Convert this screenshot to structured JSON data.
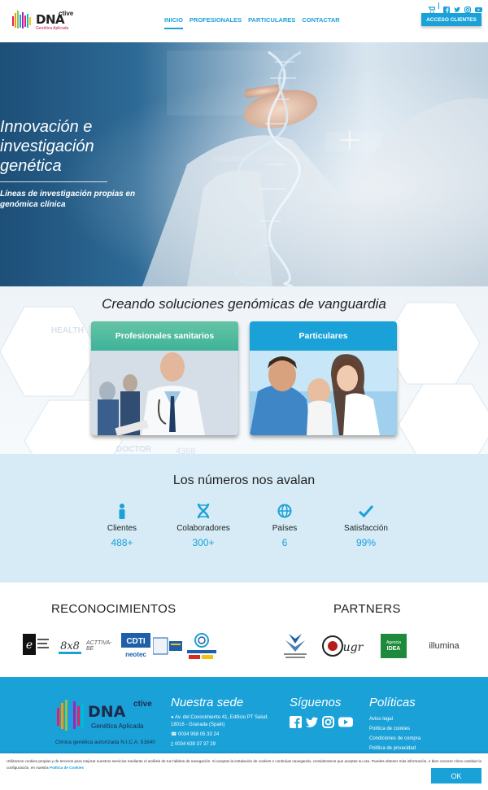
{
  "brand": {
    "name": "DNA",
    "superscript": "ctive",
    "tagline": "Genética Aplicada"
  },
  "nav": {
    "items": [
      "INICIO",
      "PROFESIONALES",
      "PARTICULARES",
      "CONTACTAR"
    ],
    "active": "INICIO"
  },
  "top_icons": [
    "cart-icon",
    "facebook-icon",
    "twitter-icon",
    "instagram-icon",
    "youtube-icon"
  ],
  "access_button": "ACCESO CLIENTES",
  "hero": {
    "title": "Innovación e investigación genética",
    "subtitle": "Líneas de investigación propias en genómica clínica"
  },
  "solutions": {
    "heading": "Creando soluciones genómicas de vanguardia",
    "background_words": [
      "HEALTH",
      "DOCTOR",
      "4368"
    ],
    "cards": [
      {
        "title": "Profesionales sanitarios",
        "color": "#3eb39a"
      },
      {
        "title": "Particulares",
        "color": "#1aa1d8"
      }
    ]
  },
  "numbers": {
    "heading": "Los números nos avalan",
    "stats": [
      {
        "icon": "person-icon",
        "label": "Clientes",
        "value": "488+"
      },
      {
        "icon": "dna-icon",
        "label": "Colaboradores",
        "value": "300+"
      },
      {
        "icon": "globe-icon",
        "label": "Países",
        "value": "6"
      },
      {
        "icon": "checkmark-icon",
        "label": "Satisfacción",
        "value": "99%"
      }
    ]
  },
  "recognition": {
    "heading": "RECONOCIMIENTOS",
    "logos": [
      "EIBT",
      "8x8",
      "ACTTIVA-BE",
      "CDTI",
      "neotec",
      "Instrumento PYME"
    ]
  },
  "partners": {
    "heading": "PARTNERS",
    "logos": [
      "Parque Tecnológico Salud",
      "ugr",
      "Agencia IDEA",
      "illumina"
    ]
  },
  "footer": {
    "clinic_note": "Clínica genética autorizada N.I.C.A. 51640",
    "hq": {
      "heading": "Nuestra sede",
      "address": "Av. del Conocimiento 41, Edificio PT Salud. 18016 - Granada (Spain)",
      "phone1": "0034 958 05 33 24",
      "phone2": "0034 639 37 37 29"
    },
    "follow": {
      "heading": "Síguenos",
      "icons": [
        "facebook-icon",
        "twitter-icon",
        "instagram-icon",
        "youtube-icon"
      ]
    },
    "policies": {
      "heading": "Políticas",
      "items": [
        "Aviso legal",
        "Política de cookies",
        "Condiciones de compra",
        "Política de privacidad"
      ]
    }
  },
  "cookie": {
    "text": "Utilizamos cookies propias y de terceros para mejorar nuestros servicios mediante el análisis de tus hábitos de navegación. Si aceptas la instalación de cookies o continúas navegando, consideramos que aceptas su uso. Puedes obtener más información, o bien conocer cómo cambiar la configuración, en nuestra",
    "link": "Política de Cookies",
    "ok": "OK"
  },
  "colors": {
    "accent": "#1aa1d8",
    "green": "#3eb39a",
    "navy": "#1c2b4a",
    "light_blue": "#d6ebf6"
  }
}
